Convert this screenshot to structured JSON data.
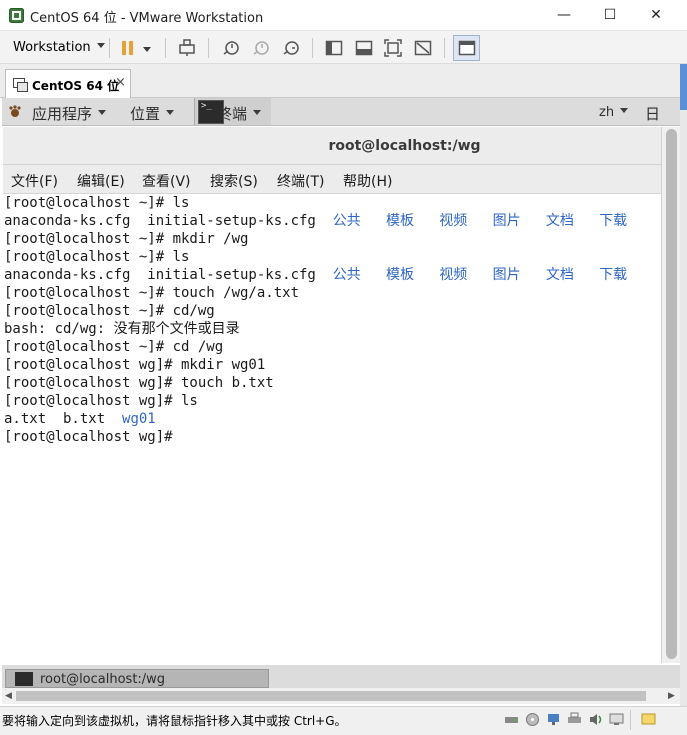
{
  "window": {
    "title": "CentOS 64 位 - VMware Workstation",
    "minimize_glyph": "—",
    "maximize_glyph": "☐",
    "close_glyph": "✕"
  },
  "toolbar": {
    "workstation_label": "Workstation",
    "icons": [
      "pause-icon",
      "send-keys-icon",
      "snapshot-icon",
      "revert-snapshot-icon",
      "snapshot-manager-icon",
      "console-view-icon",
      "thumbnail-icon",
      "fullscreen-icon",
      "unity-icon",
      "library-view-icon"
    ]
  },
  "tabs": [
    {
      "label": "CentOS 64 位",
      "close": "×"
    }
  ],
  "gnome_panel": {
    "applications": "应用程序",
    "places": "位置",
    "terminal": "终端",
    "terminal_icon_prompt": ">_",
    "language": "zh",
    "clock_partial": "日"
  },
  "terminal": {
    "title": "root@localhost:/wg",
    "menu": [
      "文件(F)",
      "编辑(E)",
      "查看(V)",
      "搜索(S)",
      "终端(T)",
      "帮助(H)"
    ],
    "lines": [
      {
        "text": "[root@localhost ~]# ls",
        "color": "#1a1a1a"
      },
      {
        "text": "anaconda-ks.cfg  initial-setup-ks.cfg  ",
        "blue": "公共   模板   视频   图片   文档   下载"
      },
      {
        "text": "[root@localhost ~]# mkdir /wg"
      },
      {
        "text": "[root@localhost ~]# ls"
      },
      {
        "text": "anaconda-ks.cfg  initial-setup-ks.cfg  ",
        "blue": "公共   模板   视频   图片   文档   下载"
      },
      {
        "text": "[root@localhost ~]# touch /wg/a.txt"
      },
      {
        "text": "[root@localhost ~]# cd/wg"
      },
      {
        "text": "bash: cd/wg: 没有那个文件或目录"
      },
      {
        "text": "[root@localhost ~]# cd /wg"
      },
      {
        "text": "[root@localhost wg]# mkdir wg01"
      },
      {
        "text": "[root@localhost wg]# touch b.txt"
      },
      {
        "text": "[root@localhost wg]# ls"
      },
      {
        "text": "a.txt  b.txt  ",
        "blue": "wg01"
      },
      {
        "text": "[root@localhost wg]# "
      }
    ]
  },
  "taskbar": {
    "item_label": "root@localhost:/wg"
  },
  "statusbar": {
    "message": "要将输入定向到该虚拟机，请将鼠标指针移入其中或按 Ctrl+G。",
    "icons": [
      "hard-disk-icon",
      "cd-dvd-icon",
      "network-icon",
      "printer-icon",
      "sound-icon",
      "display-icon",
      "message-icon"
    ]
  },
  "colors": {
    "accent_blue": "#2e66c4",
    "pause_orange": "#e8a23a"
  }
}
